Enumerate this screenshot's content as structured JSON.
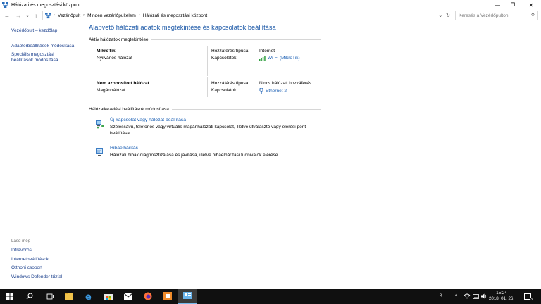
{
  "window": {
    "title": "Hálózati és megosztási központ",
    "controls": {
      "minimize": "—",
      "maximize": "❐",
      "close": "✕"
    }
  },
  "nav": {
    "back": "←",
    "forward": "→",
    "recent": "⌄",
    "up": "↑"
  },
  "address": {
    "crumbs": [
      "Vezérlőpult",
      "Minden vezérlőpultelem",
      "Hálózati és megosztási központ"
    ],
    "separator": "›",
    "dropdown": "⌄",
    "refresh": "↻"
  },
  "search": {
    "placeholder": "Keresés a Vezérlőpulton",
    "icon": "⚲"
  },
  "sidebar": {
    "items": [
      {
        "label": "Vezérlőpult – kezdőlap"
      },
      {
        "label": "Adapterbeállítások módosítása"
      },
      {
        "label": "Speciális megosztási beállítások módosítása"
      }
    ],
    "see_also_label": "Lásd még",
    "see_also": [
      {
        "label": "Infravörös"
      },
      {
        "label": "Internetbeállítások"
      },
      {
        "label": "Otthoni csoport"
      },
      {
        "label": "Windows Defender tűzfal"
      }
    ]
  },
  "main": {
    "heading": "Alapvető hálózati adatok megtekintése és kapcsolatok beállítása",
    "active_networks_title": "Aktív hálózatok megtekintése",
    "networks": [
      {
        "name": "MikroTik",
        "type": "Nyilvános hálózat",
        "access_label": "Hozzáférés típusa:",
        "access_value": "Internet",
        "connections_label": "Kapcsolatok:",
        "connection": "Wi-Fi (MikroTik)",
        "connection_icon": "wifi-icon"
      },
      {
        "name": "Nem azonosított hálózat",
        "type": "Magánhálózat",
        "access_label": "Hozzáférés típusa:",
        "access_value": "Nincs hálózati hozzáférés",
        "connections_label": "Kapcsolatok:",
        "connection": "Ethernet 2",
        "connection_icon": "ethernet-icon"
      }
    ],
    "change_settings_title": "Hálózatkezelési beállítások módosítása",
    "tasks": [
      {
        "label": "Új kapcsolat vagy hálózat beállítása",
        "description": "Szélessávú, telefonos vagy virtuális magánhálózati kapcsolat, illetve útválasztó vagy elérési pont beállítása.",
        "icon": "new-connection-icon"
      },
      {
        "label": "Hibaelhárítás",
        "description": "Hálózati hibák diagnosztizálása és javítása, illetve hibaelhárítási tudnivalók elérése.",
        "icon": "troubleshoot-icon"
      }
    ]
  },
  "taskbar": {
    "clock_time": "15:24",
    "clock_date": "2018. 01. 26.",
    "tray_lang": "ᴿ",
    "tray_up": "^",
    "tray_notifications": "3",
    "colors": {
      "background": "#101010",
      "accent": "#76b9ed"
    }
  },
  "colors": {
    "link": "#1a5fb4",
    "heading": "#1e5aa8",
    "sidebar_link": "#1a3f8c"
  }
}
